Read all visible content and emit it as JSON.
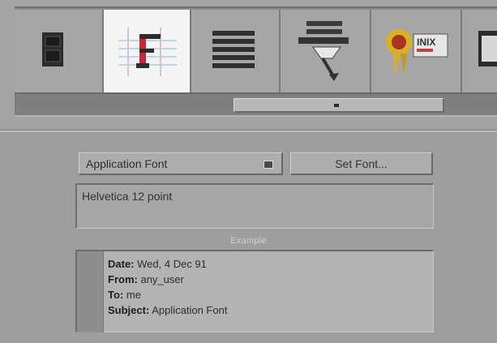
{
  "toolbar": {
    "tools": [
      {
        "name": "speaker-icon",
        "active": false
      },
      {
        "name": "font-icon",
        "active": true
      },
      {
        "name": "lines-icon",
        "active": false
      },
      {
        "name": "printer-icon",
        "active": false
      },
      {
        "name": "award-icon",
        "active": false
      },
      {
        "name": "monitor-icon",
        "active": false
      }
    ]
  },
  "font_settings": {
    "selected_option": "Application Font",
    "set_font_label": "Set Font...",
    "current_font": "Helvetica 12 point"
  },
  "example": {
    "label": "Example",
    "lines": [
      {
        "key": "Date:",
        "value": "Wed, 4 Dec 91"
      },
      {
        "key": "From:",
        "value": "any_user"
      },
      {
        "key": "To:",
        "value": "me"
      },
      {
        "key": "Subject:",
        "value": "Application Font"
      }
    ]
  }
}
